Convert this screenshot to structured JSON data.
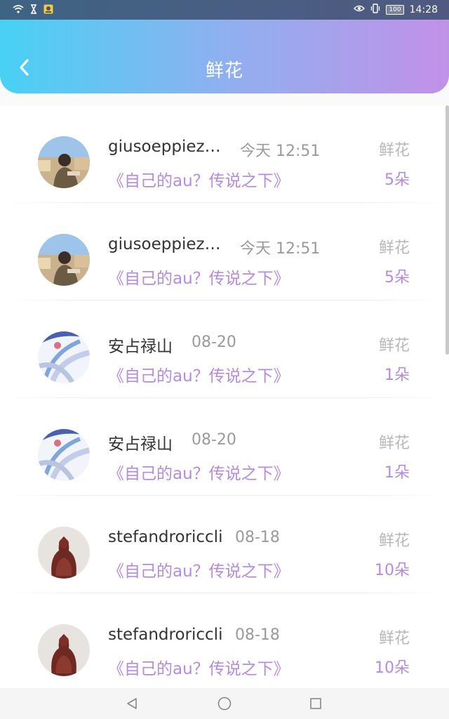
{
  "status_bar": {
    "time": "14:28",
    "battery": "100"
  },
  "header": {
    "title": "鲜花"
  },
  "colors": {
    "header_gradient_start": "#48d1f4",
    "header_gradient_end": "#c191e8",
    "accent_purple": "#b58be0",
    "name_text": "#333333",
    "muted_text": "#9a9a9a"
  },
  "records": [
    {
      "user": "giusoeppieza...",
      "time": "今天 12:51",
      "work": "《自己的au？传说之下》",
      "gift": "鲜花",
      "count": "5朵",
      "avatar": "avatar-photo-person"
    },
    {
      "user": "giusoeppieza...",
      "time": "今天 12:51",
      "work": "《自己的au？传说之下》",
      "gift": "鲜花",
      "count": "5朵",
      "avatar": "avatar-photo-person"
    },
    {
      "user": "安占禄山",
      "time": "08-20",
      "work": "《自己的au？传说之下》",
      "gift": "鲜花",
      "count": "1朵",
      "avatar": "avatar-art-swirl"
    },
    {
      "user": "安占禄山",
      "time": "08-20",
      "work": "《自己的au？传说之下》",
      "gift": "鲜花",
      "count": "1朵",
      "avatar": "avatar-art-swirl"
    },
    {
      "user": "stefandroriccli",
      "time": "08-18",
      "work": "《自己的au？传说之下》",
      "gift": "鲜花",
      "count": "10朵",
      "avatar": "avatar-statue"
    },
    {
      "user": "stefandroriccli",
      "time": "08-18",
      "work": "《自己的au？传说之下》",
      "gift": "鲜花",
      "count": "10朵",
      "avatar": "avatar-statue"
    }
  ],
  "nav": {
    "icons": [
      "back-triangle-icon",
      "home-circle-icon",
      "recents-square-icon"
    ]
  }
}
